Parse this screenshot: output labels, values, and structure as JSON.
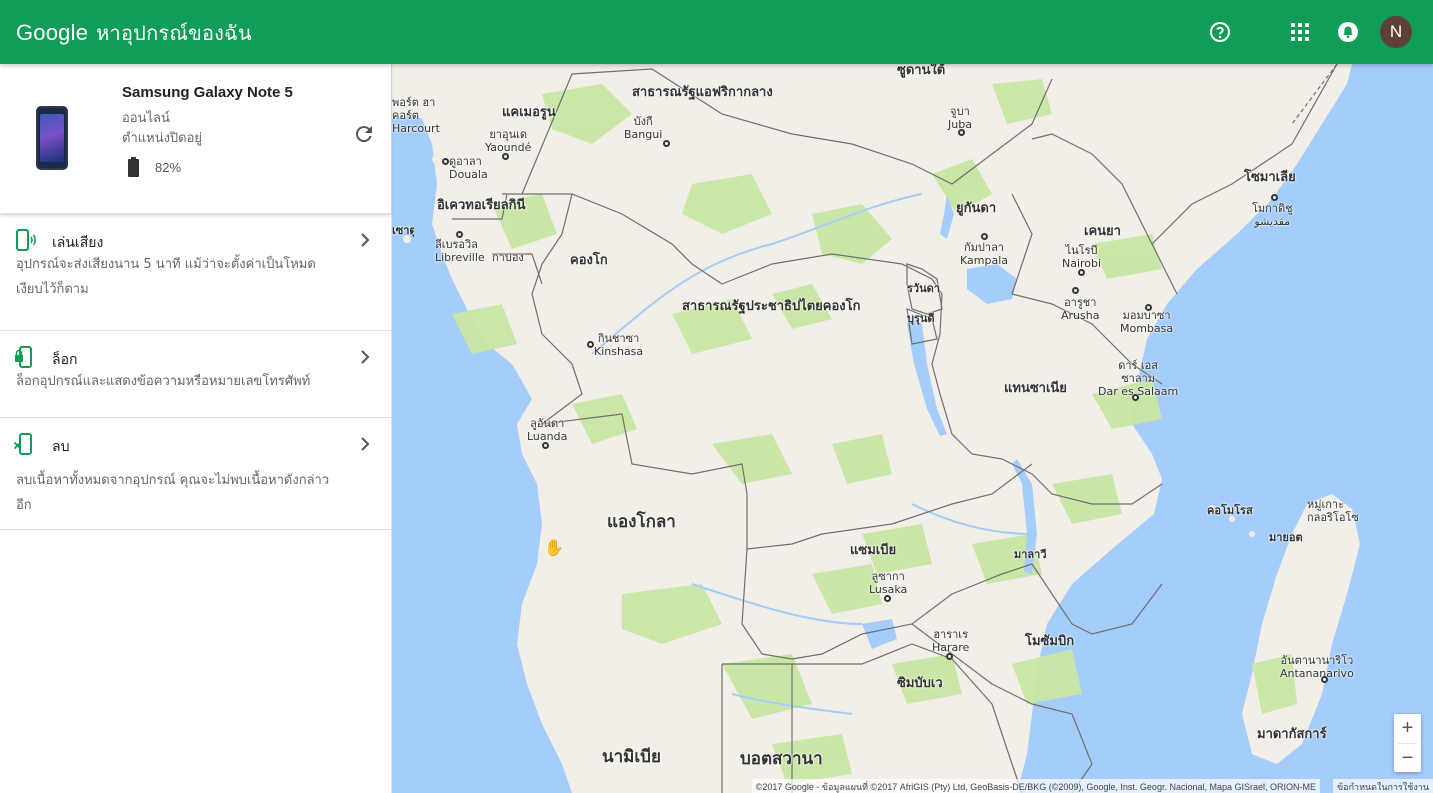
{
  "header": {
    "brand": "Google",
    "app_name": "หาอุปกรณ์ของฉัน",
    "avatar_letter": "N",
    "colors": {
      "bar": "#0f9d58",
      "avatar": "#5d4037"
    },
    "icons": [
      "help-icon",
      "apps-grid-icon",
      "notifications-icon"
    ]
  },
  "device": {
    "name": "Samsung Galaxy Note 5",
    "status": "ออนไลน์",
    "location": "ตำแหน่งปิดอยู่",
    "battery": "82%"
  },
  "actions": [
    {
      "title": "เล่นเสียง",
      "desc": "อุปกรณ์จะส่งเสียงนาน 5 นาที แม้ว่าจะตั้งค่าเป็นโหมดเงียบไว้ก็ตาม",
      "icon": "ring-phone-icon"
    },
    {
      "title": "ล็อก",
      "desc": "ล็อกอุปกรณ์และแสดงข้อความหรือหมายเลขโทรศัพท์",
      "icon": "lock-phone-icon"
    },
    {
      "title": "ลบ",
      "desc": "ลบเนื้อหาทั้งหมดจากอุปกรณ์ คุณจะไม่พบเนื้อหาดังกล่าวอีก",
      "icon": "erase-phone-icon"
    }
  ],
  "map": {
    "countries": {
      "south_sudan": "ซูดานใต้",
      "car": "สาธารณรัฐแอฟริกากลาง",
      "cameroon": "แคเมอรูน",
      "eq_guinea": "อิเควทอเรียลกินี",
      "gabon": "กาบอง",
      "congo": "คองโก",
      "drc": "สาธารณรัฐประชาธิปไตยคองโก",
      "uganda": "ยูกันดา",
      "kenya": "เคนยา",
      "somalia": "โซมาเลีย",
      "rwanda": "รวันดา",
      "burundi": "บุรุนดี",
      "tanzania": "แทนซาเนีย",
      "angola": "แองโกลา",
      "zambia": "แซมเบีย",
      "malawi": "มาลาวี",
      "mozambique": "โมซัมบิก",
      "zimbabwe": "ซิมบับเว",
      "namibia": "นามิเบีย",
      "botswana": "บอตสวานา",
      "madagascar": "มาดากัสการ์",
      "comoros": "คอโมโรส",
      "mayotte": "มายอต",
      "comoro_islands": "หมู่เกาะ\nกลอริโอโซ",
      "sao_tome": "เซาตูเม"
    },
    "cities": {
      "port_harcourt": "พอร์ต ฮา\nคอร์ต\nHarcourt",
      "yaounde": "ยาอุนเด\nYaoundé",
      "douala": "ดูอาลา\nDouala",
      "bangui": "บังกี\nBangui",
      "juba": "จูบา\nJuba",
      "libreville": "ลีเบรอวิล\nLibreville",
      "kampala": "กัมปาลา\nKampala",
      "nairobi": "ไนโรบี\nNairobi",
      "mogadishu": "โมกาดิชู\nمقديشو",
      "arusha": "อารูชา\nArusha",
      "mombasa": "มอมบาซา\nMombasa",
      "dar": "ดาร์ เอส\nซาลาม\nDar es Salaam",
      "kinshasa": "กินชาซา\nKinshasa",
      "luanda": "ลูอันดา\nLuanda",
      "lusaka": "ลูซากา\nLusaka",
      "harare": "ฮาราเร\nHarare",
      "antananarivo": "อันตานานาริโว\nAntananarivo"
    },
    "zoom_in": "+",
    "zoom_out": "−",
    "attribution": "©2017 Google - ข้อมูลแผนที่ ©2017 AfriGIS (Pty) Ltd, GeoBasis-DE/BKG (©2009), Google, Inst. Geogr. Nacional, Mapa GISrael, ORION-ME",
    "terms": "ข้อกำหนดในการใช้งาน",
    "colors": {
      "water": "#a5cdfb",
      "land": "#f2efe9",
      "green": "#c8e6a4",
      "border": "#6f6f6f"
    }
  }
}
